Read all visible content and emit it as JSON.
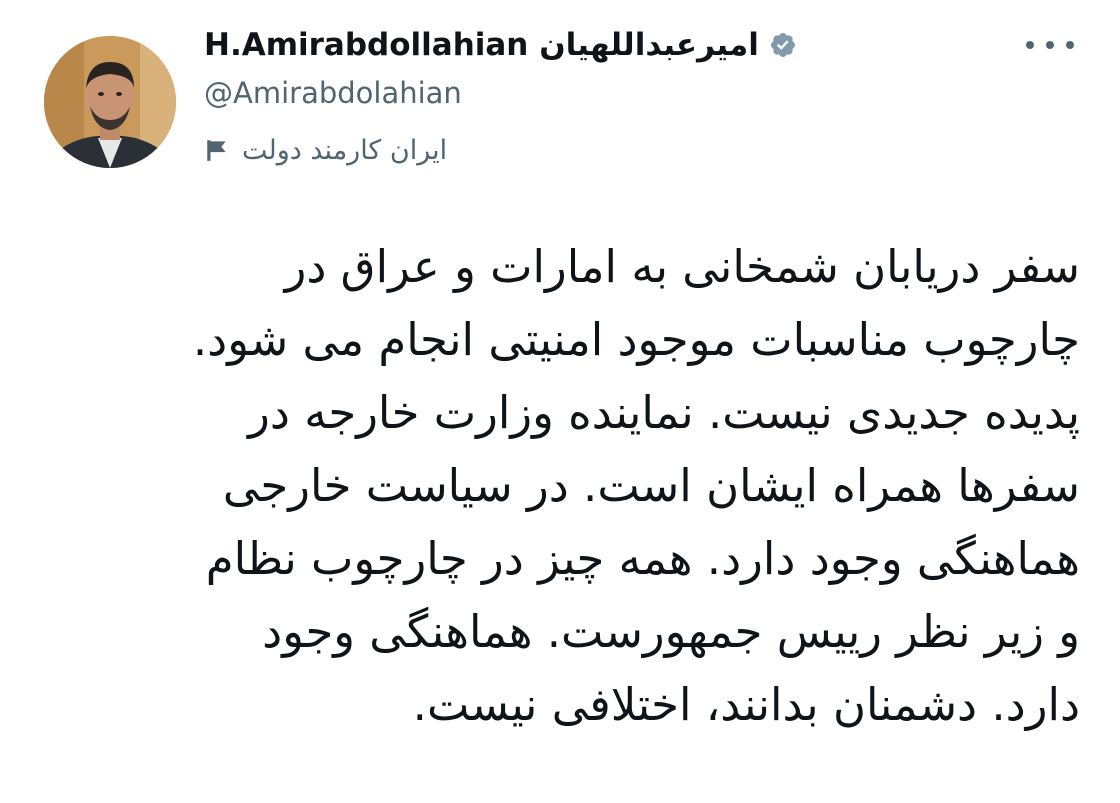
{
  "account": {
    "display_name": "H.Amirabdollahian امیرعبداللهیان",
    "handle": "@Amirabdolahian",
    "label": "ایران کارمند دولت",
    "verified": true,
    "verified_color": "#829aab"
  },
  "tweet": {
    "lines": [
      "سفر دریابان شمخانی به امارات و عراق در",
      "چارچوب مناسبات موجود امنیتی انجام می شود.",
      "پدیده جدیدی نیست. نماینده وزارت خارجه در",
      "سفرها همراه ایشان است. در سیاست خارجی",
      "هماهنگی وجود دارد. همه چیز در چارچوب نظام",
      "و زیر نظر رییس جمهورست. هماهنگی وجود",
      "دارد. دشمنان بدانند، اختلافی نیست."
    ]
  },
  "icons": {
    "verified": "verified-badge-icon",
    "label": "flag-icon",
    "more": "more-dots-icon"
  },
  "colors": {
    "text_primary": "#0f1419",
    "text_secondary": "#536471",
    "background": "#ffffff"
  }
}
